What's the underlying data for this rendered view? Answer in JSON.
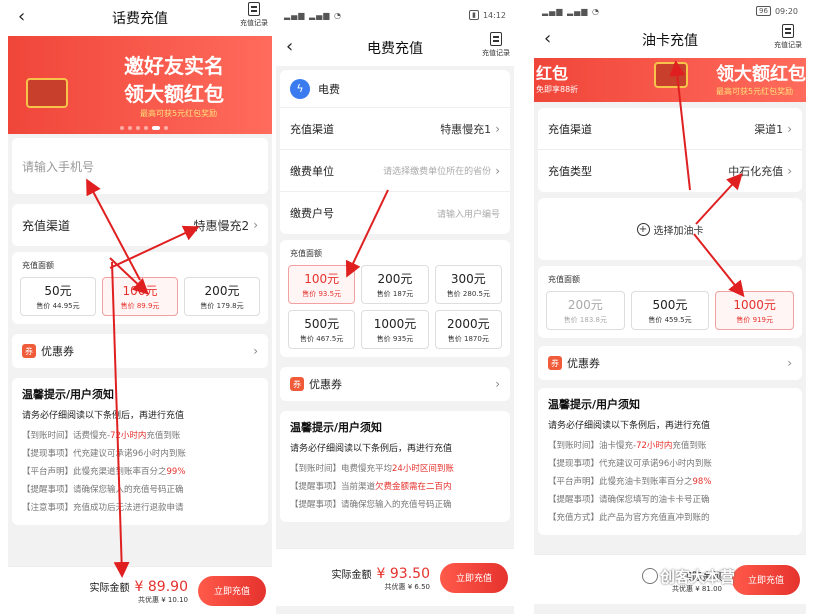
{
  "phone1": {
    "title": "话费充值",
    "record_label": "充值记录",
    "banner_title1": "邀好友实名",
    "banner_title2": "领大额红包",
    "banner_sub": "最高可获5元红包奖励",
    "phone_placeholder": "请输入手机号",
    "channel_label": "充值渠道",
    "channel_value": "特惠慢充2",
    "amount_label": "充值面额",
    "amounts": [
      {
        "amount": "50元",
        "price": "售价 44.95元"
      },
      {
        "amount": "100元",
        "price": "售价 89.9元"
      },
      {
        "amount": "200元",
        "price": "售价 179.8元"
      }
    ],
    "coupon_label": "优惠券",
    "tips_title": "温馨提示/用户须知",
    "tips_sub": "请务必仔细阅读以下条例后，再进行充值",
    "tips": [
      {
        "a": "【到账时间】话费慢充-",
        "b": "72小时内",
        "c": "充值到账"
      },
      {
        "a": "【提现事项】代充建议可承诺96小时内到账",
        "b": "",
        "c": ""
      },
      {
        "a": "【平台声明】此慢充渠道到账率百分之",
        "b": "99%",
        "c": ""
      },
      {
        "a": "【提醒事项】请确保您输入的充值号码正确",
        "b": "",
        "c": ""
      },
      {
        "a": "【注意事项】充值成功后无法进行退款申请",
        "b": "",
        "c": ""
      }
    ],
    "total_label": "实际金额",
    "total_value": "¥ 89.90",
    "discount": "共优惠 ¥ 10.10",
    "pay_label": "立即充值"
  },
  "phone2": {
    "status_time": "14:12",
    "title": "电费充值",
    "record_label": "充值记录",
    "type_label": "电费",
    "channel_label": "充值渠道",
    "channel_value": "特惠慢充1",
    "unit_label": "缴费单位",
    "unit_placeholder": "请选择缴费单位所在的省份",
    "account_label": "缴费户号",
    "account_placeholder": "请输入用户编号",
    "amount_label": "充值面额",
    "amounts": [
      {
        "amount": "100元",
        "price": "售价 93.5元"
      },
      {
        "amount": "200元",
        "price": "售价 187元"
      },
      {
        "amount": "300元",
        "price": "售价 280.5元"
      },
      {
        "amount": "500元",
        "price": "售价 467.5元"
      },
      {
        "amount": "1000元",
        "price": "售价 935元"
      },
      {
        "amount": "2000元",
        "price": "售价 1870元"
      }
    ],
    "coupon_label": "优惠券",
    "tips_title": "温馨提示/用户须知",
    "tips_sub": "请务必仔细阅读以下条例后，再进行充值",
    "tips": [
      {
        "a": "【到账时间】电费慢充平均",
        "b": "24小时区间到账",
        "c": ""
      },
      {
        "a": "【提醒事项】当前渠道",
        "b": "欠费金额需在二百内",
        "c": ""
      },
      {
        "a": "【提醒事项】请确保您输入的充值号码正确",
        "b": "",
        "c": ""
      }
    ],
    "total_label": "实际金额",
    "total_value": "¥ 93.50",
    "discount": "共优惠 ¥ 6.50",
    "pay_label": "立即充值"
  },
  "phone3": {
    "status_time": "09:20",
    "status_battery": "96",
    "title": "油卡充值",
    "record_label": "充值记录",
    "banner_title": "领大额红包",
    "banner_left": "红包",
    "banner_left_sub": "免即享88折",
    "banner_sub": "最高可获5元红包奖励",
    "channel_label": "充值渠道",
    "channel_value": "渠道1",
    "type_label": "充值类型",
    "type_value": "中石化充值",
    "add_card_label": "选择加油卡",
    "amount_label": "充值面额",
    "amounts": [
      {
        "amount": "200元",
        "price": "售价 183.8元"
      },
      {
        "amount": "500元",
        "price": "售价 459.5元"
      },
      {
        "amount": "1000元",
        "price": "售价 919元"
      }
    ],
    "coupon_label": "优惠券",
    "tips_title": "温馨提示/用户须知",
    "tips_sub": "请务必仔细阅读以下条例后，再进行充值",
    "tips": [
      {
        "a": "【到账时间】油卡慢充-",
        "b": "72小时内",
        "c": "充值到账"
      },
      {
        "a": "【提现事项】代充建议可承诺96小时内到账",
        "b": "",
        "c": ""
      },
      {
        "a": "【平台声明】此慢充油卡到账率百分之",
        "b": "98%",
        "c": ""
      },
      {
        "a": "【提醒事项】请确保您填写的油卡卡号正确",
        "b": "",
        "c": ""
      },
      {
        "a": "【充值方式】此产品为官方充值直冲到账的",
        "b": "",
        "c": ""
      }
    ],
    "total_label": "实际金额",
    "discount": "共优惠 ¥ 81.00",
    "pay_label": "立即充值"
  },
  "watermark": "创客大本营",
  "colors": {
    "accent": "#e5322d",
    "arrow": "#e02020",
    "bolt": "#3a7cf0"
  }
}
